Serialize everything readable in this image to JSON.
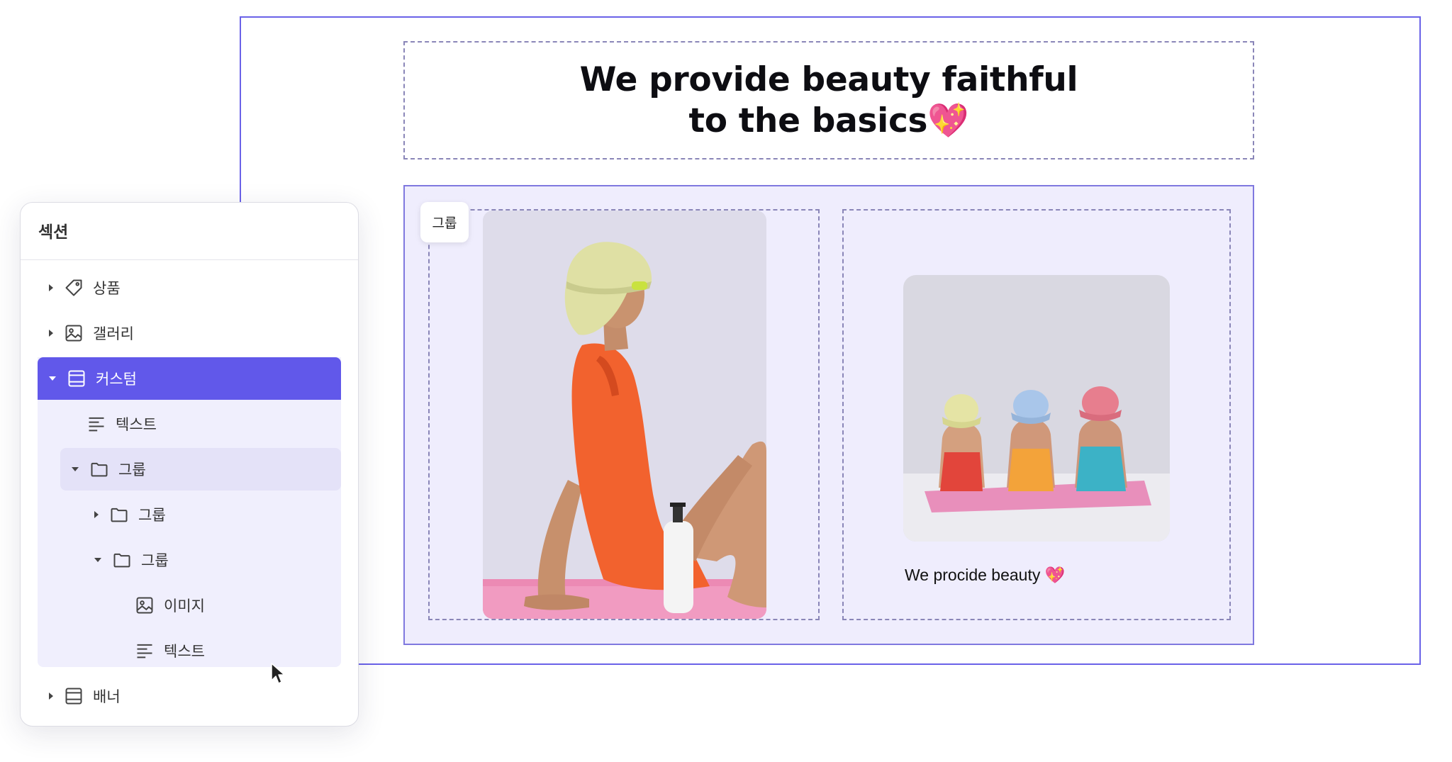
{
  "canvas": {
    "title": "We provide beauty faithful\nto the basics💖",
    "group_tag": "그룹",
    "caption": "We procide beauty 💖",
    "accent_color": "#6a62e8"
  },
  "panel": {
    "title": "섹션",
    "items": [
      {
        "label": "상품",
        "icon": "tag-icon",
        "caret": "right"
      },
      {
        "label": "갤러리",
        "icon": "image-icon",
        "caret": "right"
      },
      {
        "label": "커스텀",
        "icon": "layout-icon",
        "caret": "down",
        "state": "active"
      },
      {
        "label": "텍스트",
        "icon": "text-icon",
        "caret": "none"
      },
      {
        "label": "그룹",
        "icon": "folder-icon",
        "caret": "down",
        "state": "hover"
      },
      {
        "label": "그룹",
        "icon": "folder-icon",
        "caret": "right"
      },
      {
        "label": "그룹",
        "icon": "folder-icon",
        "caret": "down"
      },
      {
        "label": "이미지",
        "icon": "image-icon",
        "caret": "none"
      },
      {
        "label": "텍스트",
        "icon": "text-icon",
        "caret": "none"
      },
      {
        "label": "배너",
        "icon": "layout-icon",
        "caret": "right"
      }
    ],
    "active_color": "#6158ea"
  }
}
